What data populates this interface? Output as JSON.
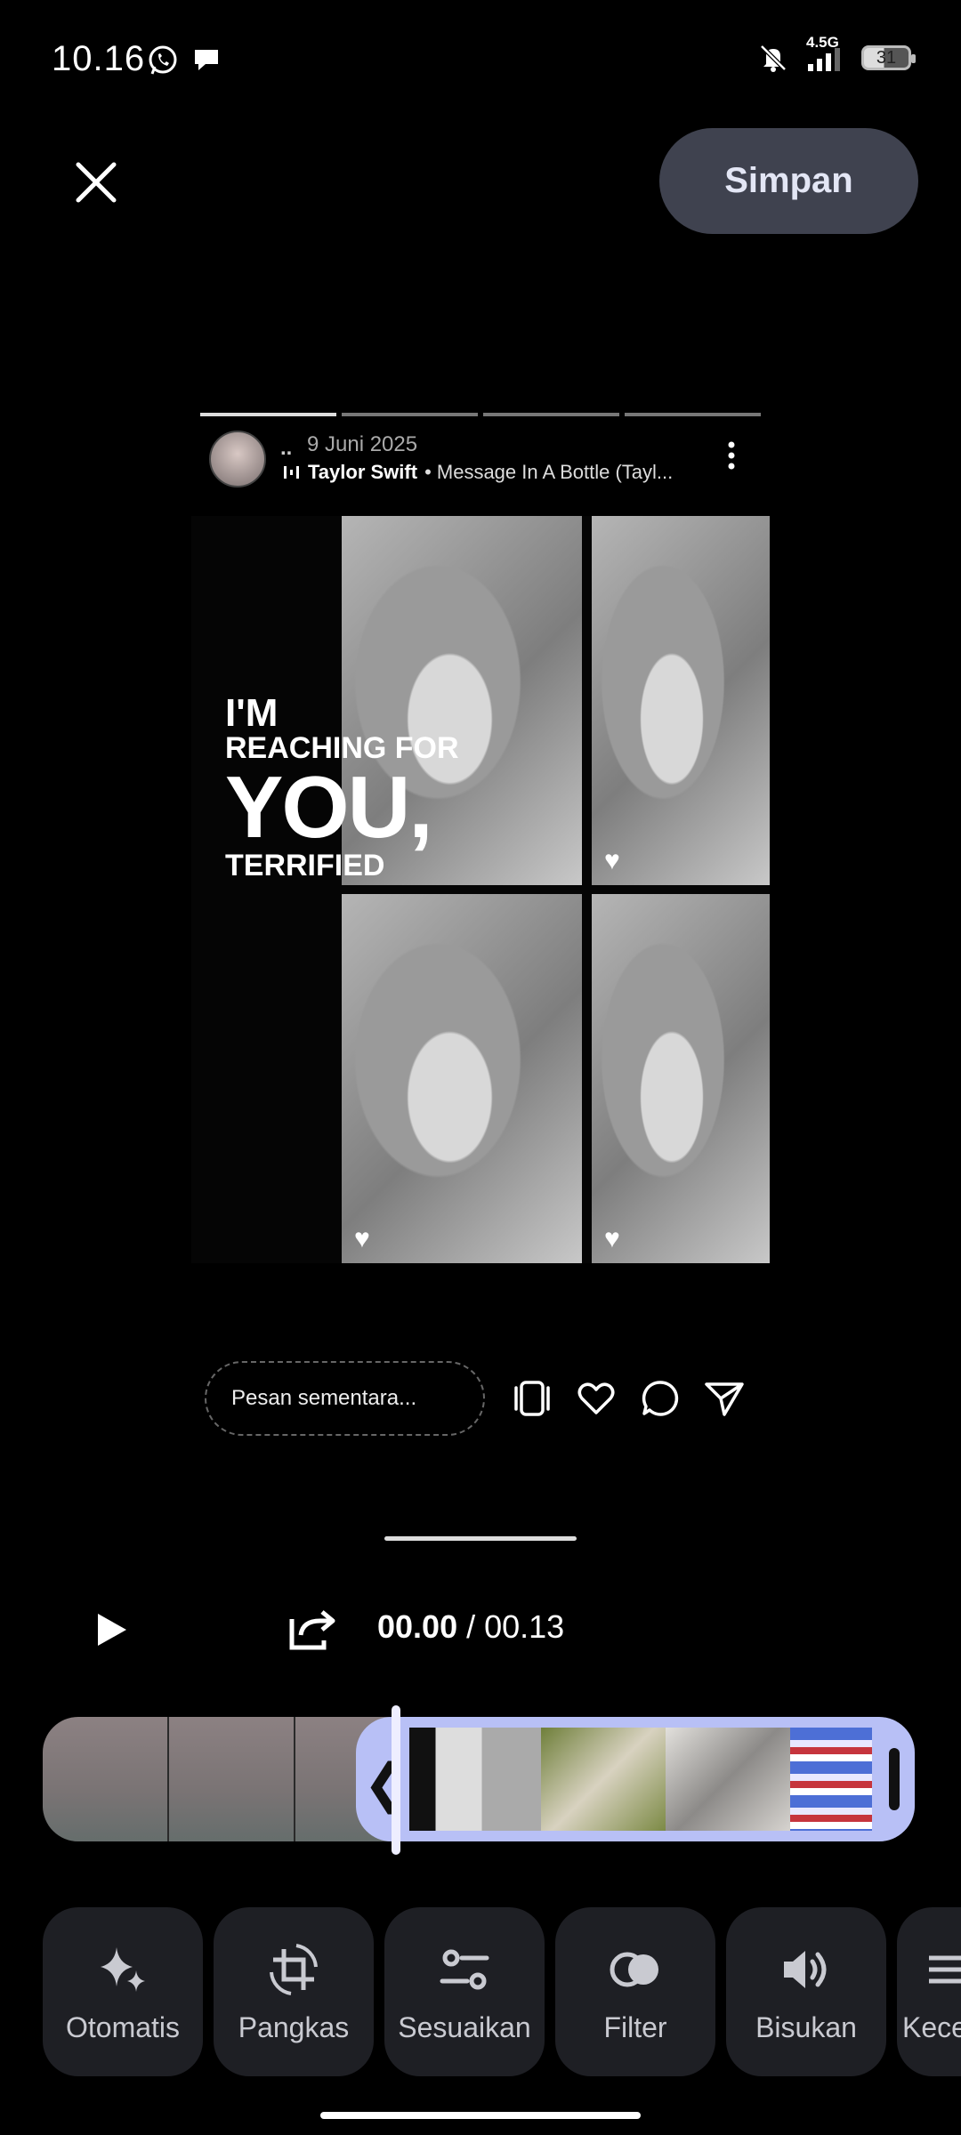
{
  "status_bar": {
    "time": "10.16",
    "network": "4.5G",
    "battery": "31"
  },
  "top": {
    "save_label": "Simpan"
  },
  "story": {
    "user_dots": "..",
    "date": "9 Juni 2025",
    "artist": "Taylor Swift",
    "song": "• Message In A Bottle (Tayl...",
    "lyric_lines": [
      "I'M",
      "REACHING FOR",
      "YOU,",
      "TERRIFIED"
    ]
  },
  "reply": {
    "placeholder": "Pesan sementara..."
  },
  "playback": {
    "current": "00.00",
    "separator": " / ",
    "total": "00.13"
  },
  "tools": [
    {
      "label": "Otomatis",
      "icon": "sparkle-icon"
    },
    {
      "label": "Pangkas",
      "icon": "crop-rotate-icon"
    },
    {
      "label": "Sesuaikan",
      "icon": "adjust-icon"
    },
    {
      "label": "Filter",
      "icon": "filter-icon"
    },
    {
      "label": "Bisukan",
      "icon": "volume-icon"
    },
    {
      "label": "Kece",
      "icon": "speed-icon"
    }
  ],
  "colors": {
    "save_bg": "#3f424f",
    "trim_accent": "#b8c0f6",
    "tool_bg": "#1e1f24"
  }
}
